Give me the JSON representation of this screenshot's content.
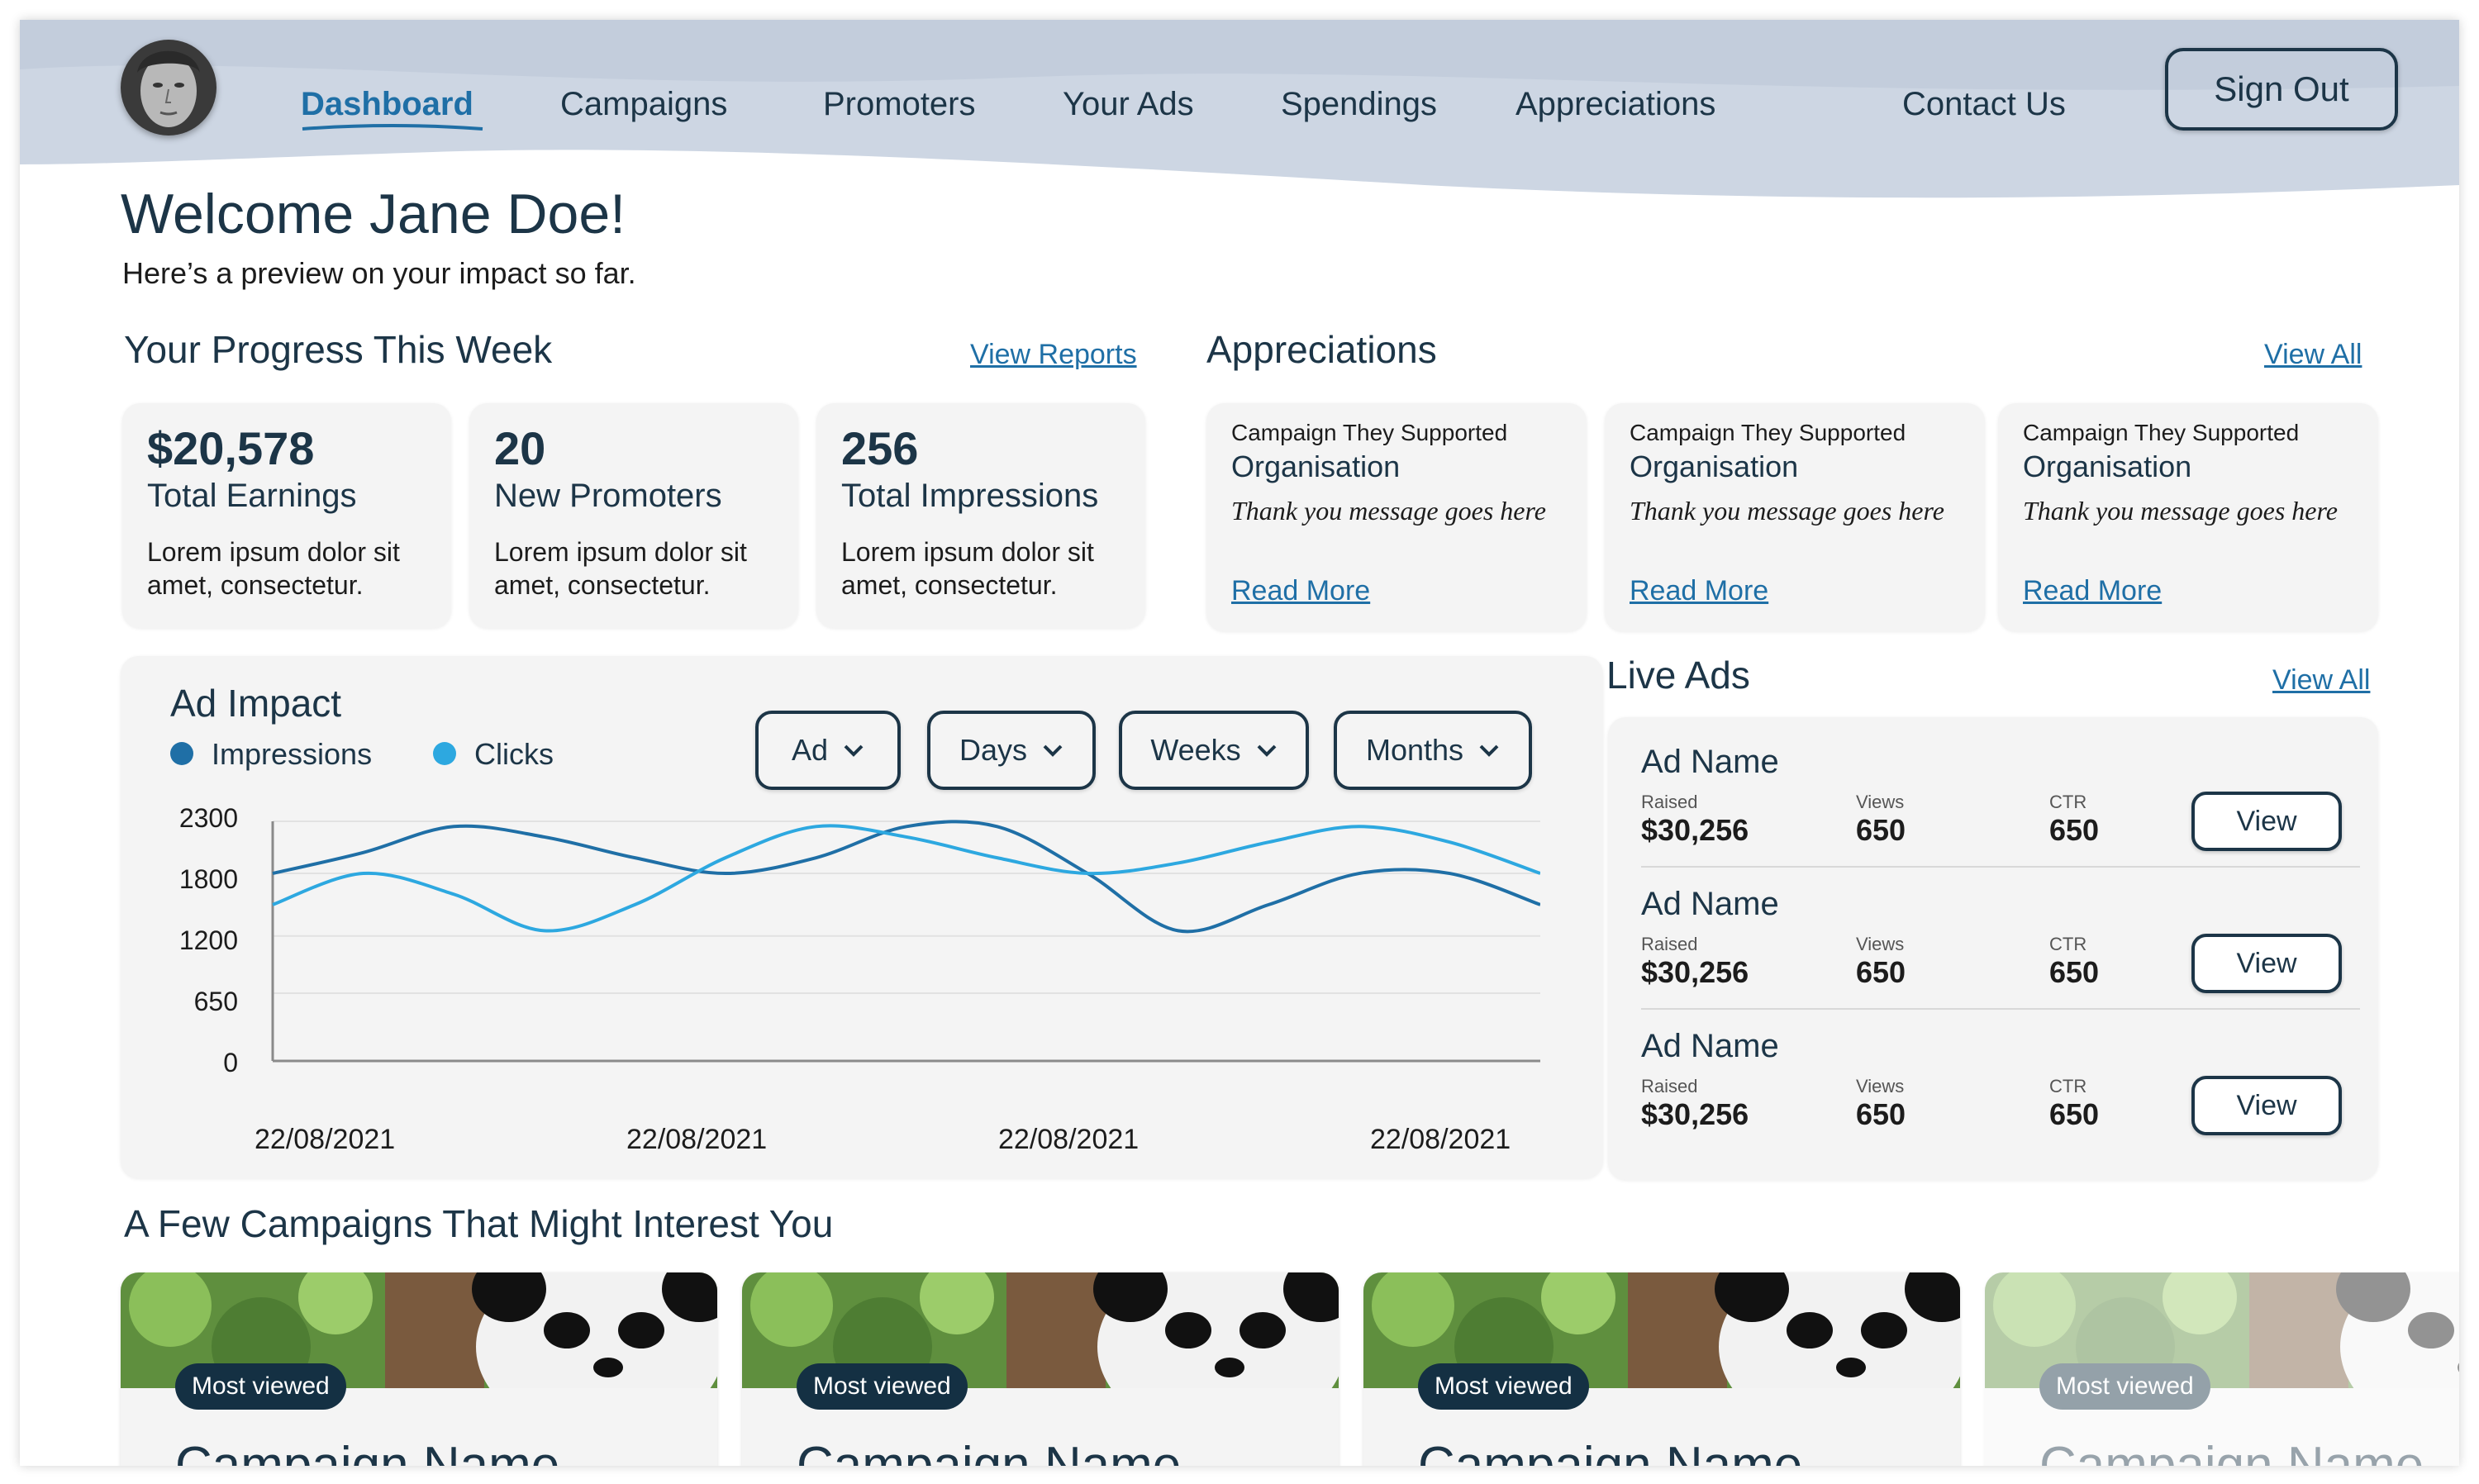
{
  "nav": {
    "items": [
      {
        "label": "Dashboard",
        "active": true
      },
      {
        "label": "Campaigns"
      },
      {
        "label": "Promoters"
      },
      {
        "label": "Your Ads"
      },
      {
        "label": "Spendings"
      },
      {
        "label": "Appreciations"
      }
    ],
    "contact": "Contact Us",
    "signout": "Sign Out"
  },
  "welcome": {
    "title": "Welcome Jane Doe!",
    "subtitle": "Here’s a preview on your impact so far."
  },
  "progress": {
    "title": "Your Progress This Week",
    "link": "View Reports",
    "cards": [
      {
        "value": "$20,578",
        "label": "Total Earnings",
        "desc": "Lorem ipsum dolor sit amet, consectetur."
      },
      {
        "value": "20",
        "label": "New Promoters",
        "desc": "Lorem ipsum dolor sit amet, consectetur."
      },
      {
        "value": "256",
        "label": "Total Impressions",
        "desc": "Lorem ipsum dolor sit amet, consectetur."
      }
    ]
  },
  "appreciations": {
    "title": "Appreciations",
    "link": "View All",
    "cards": [
      {
        "heading": "Campaign They Supported",
        "org": "Organisation",
        "message": "Thank you message goes here",
        "link": "Read More"
      },
      {
        "heading": "Campaign They Supported",
        "org": "Organisation",
        "message": "Thank you message goes here",
        "link": "Read More"
      },
      {
        "heading": "Campaign They Supported",
        "org": "Organisation",
        "message": "Thank you message goes here",
        "link": "Read More"
      }
    ]
  },
  "ad_impact": {
    "title": "Ad Impact",
    "dropdowns": [
      "Ad",
      "Days",
      "Weeks",
      "Months"
    ],
    "legend": [
      {
        "label": "Impressions",
        "color": "#1f6fa6"
      },
      {
        "label": "Clicks",
        "color": "#2da8e0"
      }
    ]
  },
  "chart_data": {
    "type": "line",
    "title": "Ad Impact",
    "y_ticks": [
      "2300",
      "1800",
      "1200",
      "650",
      "0"
    ],
    "x_ticks": [
      "22/08/2021",
      "22/08/2021",
      "22/08/2021",
      "22/08/2021"
    ],
    "ylim": [
      0,
      2300
    ],
    "grid": true,
    "legend_position": "top-left",
    "series": [
      {
        "name": "Impressions",
        "color": "#1f6fa6",
        "x": [
          0,
          0.5,
          1,
          1.5,
          2,
          2.5,
          3,
          3.5,
          4,
          4.5,
          5,
          5.5,
          6,
          6.5,
          7
        ],
        "values": [
          1800,
          2000,
          2250,
          2150,
          1950,
          1800,
          1950,
          2250,
          2250,
          1800,
          1250,
          1500,
          1800,
          1800,
          1500
        ]
      },
      {
        "name": "Clicks",
        "color": "#2da8e0",
        "x": [
          0,
          0.5,
          1,
          1.5,
          2,
          2.5,
          3,
          3.5,
          4,
          4.5,
          5,
          5.5,
          6,
          6.5,
          7
        ],
        "values": [
          1500,
          1800,
          1600,
          1250,
          1500,
          1950,
          2250,
          2150,
          1950,
          1800,
          1900,
          2100,
          2250,
          2100,
          1800
        ]
      }
    ]
  },
  "live_ads": {
    "title": "Live Ads",
    "link": "View All",
    "labels": {
      "raised": "Raised",
      "views": "Views",
      "ctr": "CTR",
      "button": "View"
    },
    "items": [
      {
        "name": "Ad Name",
        "raised": "$30,256",
        "views": "650",
        "ctr": "650"
      },
      {
        "name": "Ad Name",
        "raised": "$30,256",
        "views": "650",
        "ctr": "650"
      },
      {
        "name": "Ad Name",
        "raised": "$30,256",
        "views": "650",
        "ctr": "650"
      }
    ]
  },
  "campaigns": {
    "title": "A Few Campaigns That Might Interest You",
    "items": [
      {
        "badge": "Most viewed",
        "name": "Campaign Name"
      },
      {
        "badge": "Most viewed",
        "name": "Campaign Name"
      },
      {
        "badge": "Most viewed",
        "name": "Campaign Name"
      },
      {
        "badge": "Most viewed",
        "name": "Campaign Name"
      }
    ]
  }
}
